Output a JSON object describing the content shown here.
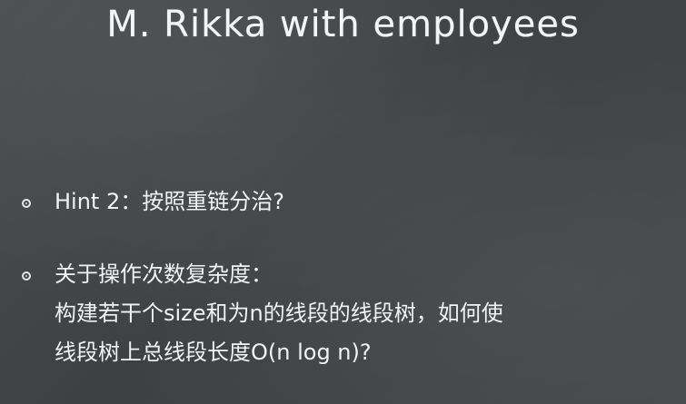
{
  "title": "M. Rikka with employees",
  "bullets": [
    {
      "lines": [
        "Hint 2：按照重链分治?"
      ]
    },
    {
      "lines": [
        "关于操作次数复杂度：",
        "构建若干个size和为n的线段的线段树，如何使",
        "线段树上总线段长度O(n log n)?"
      ]
    }
  ]
}
